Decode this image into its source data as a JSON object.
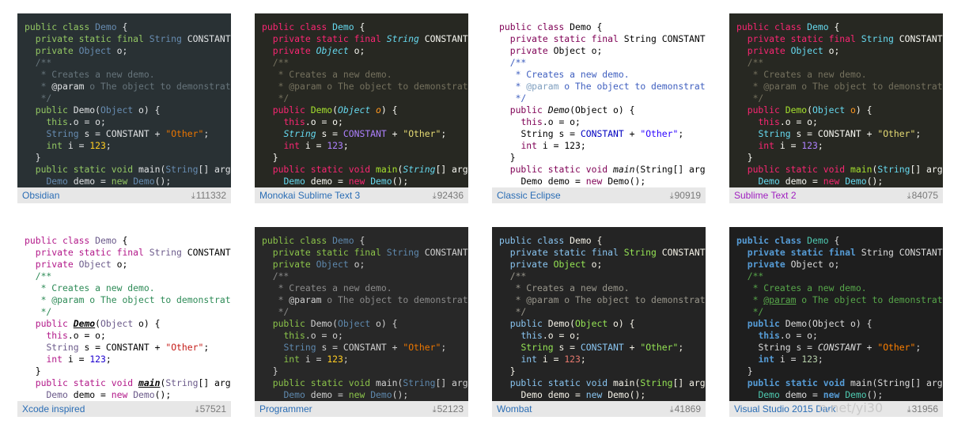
{
  "code_lines": [
    [
      "public class Demo {"
    ],
    [
      "  private static final String CONSTANT"
    ],
    [
      "  private Object o;"
    ],
    [
      "  /**"
    ],
    [
      "   * Creates a new demo."
    ],
    [
      "   * @param o The object to demonstrate"
    ],
    [
      "   */"
    ],
    [
      "  public Demo(Object o) {"
    ],
    [
      "    this.o = o;"
    ],
    [
      "    String s = CONSTANT + \"Other\";"
    ],
    [
      "    int i = 123;"
    ],
    [
      "  }"
    ],
    [
      "  public static void main(String[] args"
    ],
    [
      "    Demo demo = new Demo();"
    ]
  ],
  "themes": [
    {
      "name": "Obsidian",
      "downloads": "111332",
      "bg": "#293134",
      "name_color": "#2a6db5",
      "colors": {
        "kw": "#93c763",
        "type": "#678cb1",
        "tx": "#e0e2e4",
        "cm": "#66747b",
        "str": "#ec7600",
        "num": "#ffcd22",
        "cls": "#678cb1",
        "fn": "#e0e2e4",
        "par": "#e0e2e4",
        "const": "#e0e2e4",
        "ann": "#e0e2e4"
      }
    },
    {
      "name": "Monokai Sublime Text 3",
      "downloads": "92436",
      "bg": "#272822",
      "name_color": "#2a6db5",
      "colors": {
        "kw": "#f92672",
        "type": "#66d9ef",
        "tx": "#f8f8f2",
        "cm": "#75715e",
        "str": "#e6db74",
        "num": "#ae81ff",
        "cls": "#66d9ef",
        "fn": "#a6e22e",
        "par": "#fd971f",
        "const": "#ae81ff",
        "ann": "#75715e"
      }
    },
    {
      "name": "Classic Eclipse",
      "downloads": "90919",
      "bg": "#ffffff",
      "name_color": "#2a6db5",
      "colors": {
        "kw": "#7f0055",
        "type": "#000000",
        "tx": "#000000",
        "cm": "#3f5fbf",
        "str": "#2a00ff",
        "num": "#000000",
        "cls": "#000000",
        "fn": "#000000",
        "par": "#000000",
        "const": "#0000c0",
        "ann": "#7f9fbf"
      }
    },
    {
      "name": "Sublime Text 2",
      "downloads": "84075",
      "bg": "#272822",
      "name_color": "#a020c0",
      "colors": {
        "kw": "#f92672",
        "type": "#66d9ef",
        "tx": "#f8f8f2",
        "cm": "#75715e",
        "str": "#e6db74",
        "num": "#ae81ff",
        "cls": "#66d9ef",
        "fn": "#a6e22e",
        "par": "#fd971f",
        "const": "#f8f8f2",
        "ann": "#75715e"
      }
    },
    {
      "name": "Xcode inspired",
      "downloads": "57521",
      "bg": "#ffffff",
      "name_color": "#2a6db5",
      "colors": {
        "kw": "#b21889",
        "type": "#6b5a8a",
        "tx": "#000000",
        "cm": "#2e8b57",
        "str": "#c41a16",
        "num": "#1c00cf",
        "cls": "#6b5a8a",
        "fn": "#000000",
        "par": "#000000",
        "const": "#000000",
        "ann": "#2e8b57"
      }
    },
    {
      "name": "Programmer",
      "downloads": "52123",
      "bg": "#282828",
      "name_color": "#2a6db5",
      "colors": {
        "kw": "#8bc34a",
        "type": "#5e88ad",
        "tx": "#d0d0d0",
        "cm": "#8a8a8a",
        "str": "#ec7600",
        "num": "#ffcd22",
        "cls": "#5e88ad",
        "fn": "#d0d0d0",
        "par": "#d0d0d0",
        "const": "#d0d0d0",
        "ann": "#d0d0d0"
      }
    },
    {
      "name": "Wombat",
      "downloads": "41869",
      "bg": "#242424",
      "name_color": "#2a6db5",
      "colors": {
        "kw": "#8ac6f2",
        "type": "#95e454",
        "tx": "#f6f3e8",
        "cm": "#99968b",
        "str": "#95e454",
        "num": "#e5786d",
        "cls": "#f6f3e8",
        "fn": "#f6f3e8",
        "par": "#f6f3e8",
        "const": "#8ac6f2",
        "ann": "#99968b"
      }
    },
    {
      "name": "Visual Studio 2015 Dark",
      "downloads": "31956",
      "bg": "#1e1e1e",
      "name_color": "#2a6db5",
      "colors": {
        "kw": "#569cd6",
        "type": "#dcdcdc",
        "tx": "#dcdcdc",
        "cm": "#57a64a",
        "str": "#ff8000",
        "num": "#b5cea8",
        "cls": "#4ec9b0",
        "fn": "#dcdcdc",
        "par": "#dcdcdc",
        "const": "#dcdcdc",
        "ann": "#57a64a"
      }
    }
  ],
  "download_icon": "download-arrow-icon",
  "watermark": "n.net/yi30"
}
